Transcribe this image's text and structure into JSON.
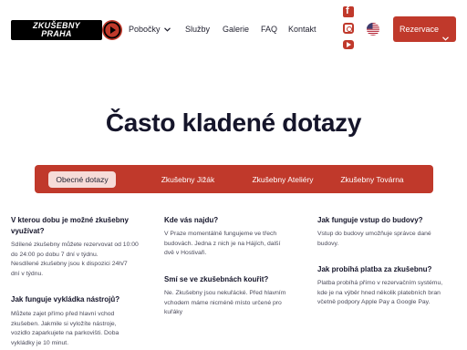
{
  "header": {
    "logo": {
      "line1": "ZKUŠEBNY",
      "line2": "PRAHA"
    },
    "nav": [
      {
        "label": "Pobočky",
        "has_dropdown": true
      },
      {
        "label": "Služby"
      },
      {
        "label": "Galerie"
      },
      {
        "label": "FAQ"
      },
      {
        "label": "Kontakt"
      }
    ],
    "social": [
      "facebook-icon",
      "instagram-icon",
      "youtube-icon"
    ],
    "language_flag": "us-flag-icon",
    "cta_label": "Rezervace",
    "accent_color": "#c0392b"
  },
  "page_title": "Často kladené dotazy",
  "tabs": [
    {
      "label": "Obecné dotazy",
      "active": true
    },
    {
      "label": "Zkušebny Jižák"
    },
    {
      "label": "Zkušebny Ateliéry"
    },
    {
      "label": "Zkušebny Továrna"
    }
  ],
  "faq": {
    "col1": [
      {
        "q": [
          "V kterou dobu je možné zkušebny",
          "využívat?"
        ],
        "a": [
          "Sdílené zkušebny můžete rezervovat od 10:00",
          "do 24:00 po dobu 7 dní v týdnu.",
          "Nesdílené zkušebny jsou k dispozici 24h/7",
          "dní v týdnu."
        ]
      },
      {
        "q": [
          "Jak funguje vykládka nástrojů?"
        ],
        "a": [
          "Můžete zajet přímo před hlavní vchod",
          "zkušeben. Jakmile si vyložíte nástroje,",
          "vozidlo zaparkujete na parkovišti. Doba",
          "vykládky je 10 minut."
        ]
      }
    ],
    "col2": [
      {
        "q": [
          "Kde vás najdu?"
        ],
        "a": [
          "V Praze momentálně fungujeme ve třech",
          "budovách. Jedna z nich je na Hájích, další",
          "dvě v Hostivaři."
        ]
      },
      {
        "q": [
          "Smí se ve zkušebnách kouřit?"
        ],
        "a": [
          "Ne. Zkušebny jsou nekuřácké. Před hlavním",
          "vchodem máme nicméně místo určené pro",
          "kuřáky"
        ]
      }
    ],
    "col3": [
      {
        "q": [
          "Jak funguje vstup do budovy?"
        ],
        "a": [
          "Vstup do budovy umožňuje správce dané",
          "budovy."
        ]
      },
      {
        "q": [
          "Jak probíhá platba za zkušebnu?"
        ],
        "a": [
          "Platba probíhá přímo v rezervačním systému,",
          "kde je na výběr hned několik platebních bran",
          "včetně podpory Apple Pay a Google Pay."
        ]
      }
    ]
  }
}
